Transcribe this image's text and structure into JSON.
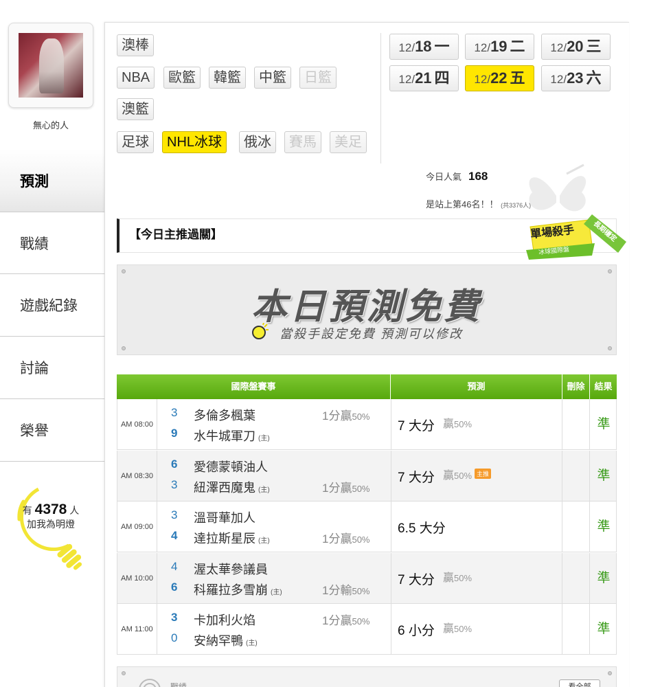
{
  "profile": {
    "username": "無心的人"
  },
  "left_nav": [
    {
      "label": "預測",
      "active": true
    },
    {
      "label": "戰績"
    },
    {
      "label": "遊戲紀錄"
    },
    {
      "label": "討論"
    },
    {
      "label": "榮譽"
    }
  ],
  "lamp": {
    "prefix": "有",
    "count": "4378",
    "suffix": "人",
    "subtext": "加我為明燈"
  },
  "sports": {
    "row1": [
      {
        "label": "澳棒"
      }
    ],
    "row2": [
      {
        "label": "NBA"
      },
      {
        "label": "歐籃"
      },
      {
        "label": "韓籃"
      },
      {
        "label": "中籃"
      },
      {
        "label": "日籃",
        "disabled": true
      }
    ],
    "row3": [
      {
        "label": "澳籃"
      }
    ],
    "row4": [
      {
        "label": "足球"
      },
      {
        "label": "NHL冰球",
        "selected": true
      },
      {
        "label": "俄冰"
      },
      {
        "label": "賽馬",
        "disabled": true
      },
      {
        "label": "美足",
        "disabled": true
      }
    ]
  },
  "dates": [
    {
      "md": "12/",
      "day": "18",
      "weekday": "一"
    },
    {
      "md": "12/",
      "day": "19",
      "weekday": "二"
    },
    {
      "md": "12/",
      "day": "20",
      "weekday": "三"
    },
    {
      "md": "12/",
      "day": "21",
      "weekday": "四"
    },
    {
      "md": "12/",
      "day": "22",
      "weekday": "五",
      "selected": true
    },
    {
      "md": "12/",
      "day": "23",
      "weekday": "六"
    }
  ],
  "popularity": {
    "label": "今日人氣",
    "value": "168",
    "rank_text": "是站上第46名！！",
    "rank_total": "(共3376人)"
  },
  "section": {
    "title": "【今日主推過關】"
  },
  "badge": {
    "main": "單場殺手",
    "sub": "冰球國際盤",
    "ribbon": "長期穩定"
  },
  "banner": {
    "title": "本日預測免費",
    "subtitle": "當殺手設定免費  預測可以修改"
  },
  "table": {
    "headers": {
      "event": "國際盤賽事",
      "prediction": "預測",
      "delete": "刪除",
      "result": "結果"
    },
    "home_mark": "(主)",
    "rows": [
      {
        "time": "AM 08:00",
        "score1": "3",
        "team1": "多倫多楓葉",
        "score2": "9",
        "team2": "水牛城軍刀",
        "home_on": 2,
        "odds_main": "1分贏",
        "odds_pct": "50%",
        "odds_line": 1,
        "pred": "7 大分",
        "pred_extra_main": "贏",
        "pred_extra_pct": "50%",
        "tag": "",
        "result": "準"
      },
      {
        "time": "AM 08:30",
        "score1": "6",
        "team1": "愛德蒙頓油人",
        "score2": "3",
        "team2": "紐澤西魔鬼",
        "home_on": 2,
        "odds_main": "1分贏",
        "odds_pct": "50%",
        "odds_line": 2,
        "pred": "7 大分",
        "pred_extra_main": "贏",
        "pred_extra_pct": "50%",
        "tag": "主推",
        "result": "準"
      },
      {
        "time": "AM 09:00",
        "score1": "3",
        "team1": "溫哥華加人",
        "score2": "4",
        "team2": "達拉斯星辰",
        "home_on": 2,
        "odds_main": "1分贏",
        "odds_pct": "50%",
        "odds_line": 2,
        "pred": "6.5 大分",
        "pred_extra_main": "",
        "pred_extra_pct": "",
        "tag": "",
        "result": "準"
      },
      {
        "time": "AM 10:00",
        "score1": "4",
        "team1": "渥太華參議員",
        "score2": "6",
        "team2": "科羅拉多雪崩",
        "home_on": 2,
        "odds_main": "1分輸",
        "odds_pct": "50%",
        "odds_line": 2,
        "pred": "7 大分",
        "pred_extra_main": "贏",
        "pred_extra_pct": "50%",
        "tag": "",
        "result": "準"
      },
      {
        "time": "AM 11:00",
        "score1": "3",
        "team1": "卡加利火焰",
        "score2": "0",
        "team2": "安納罕鴨",
        "home_on": 2,
        "odds_main": "1分贏",
        "odds_pct": "50%",
        "odds_line": 1,
        "pred": "6 小分",
        "pred_extra_main": "贏",
        "pred_extra_pct": "50%",
        "tag": "",
        "result": "準"
      }
    ]
  },
  "footer": {
    "label": "戰績",
    "button": "看全部"
  },
  "colors": {
    "accent_yellow": "#ffe600",
    "header_green": "#6cbb1f",
    "result_green": "#3a9b1a",
    "score_blue": "#2a7ab8"
  }
}
